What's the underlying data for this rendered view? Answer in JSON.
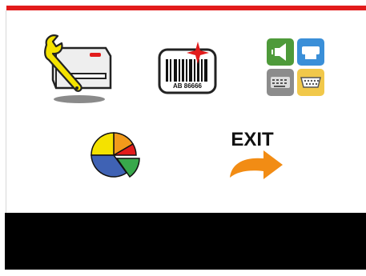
{
  "colors": {
    "top_bar": "#e21b1b",
    "status_bar": "#000000",
    "background": "#ffffff"
  },
  "menu": {
    "items": [
      {
        "id": "settings",
        "icon": "wrench-printer-icon"
      },
      {
        "id": "barcode",
        "icon": "barcode-label-icon",
        "label_text": "AB 86666"
      },
      {
        "id": "interfaces",
        "icon": "interface-ports-icon"
      },
      {
        "id": "statistics",
        "icon": "pie-chart-icon"
      },
      {
        "id": "exit",
        "icon": "exit-arrow-icon",
        "label_text": "EXIT"
      }
    ]
  },
  "status_bar": {
    "text": ""
  }
}
